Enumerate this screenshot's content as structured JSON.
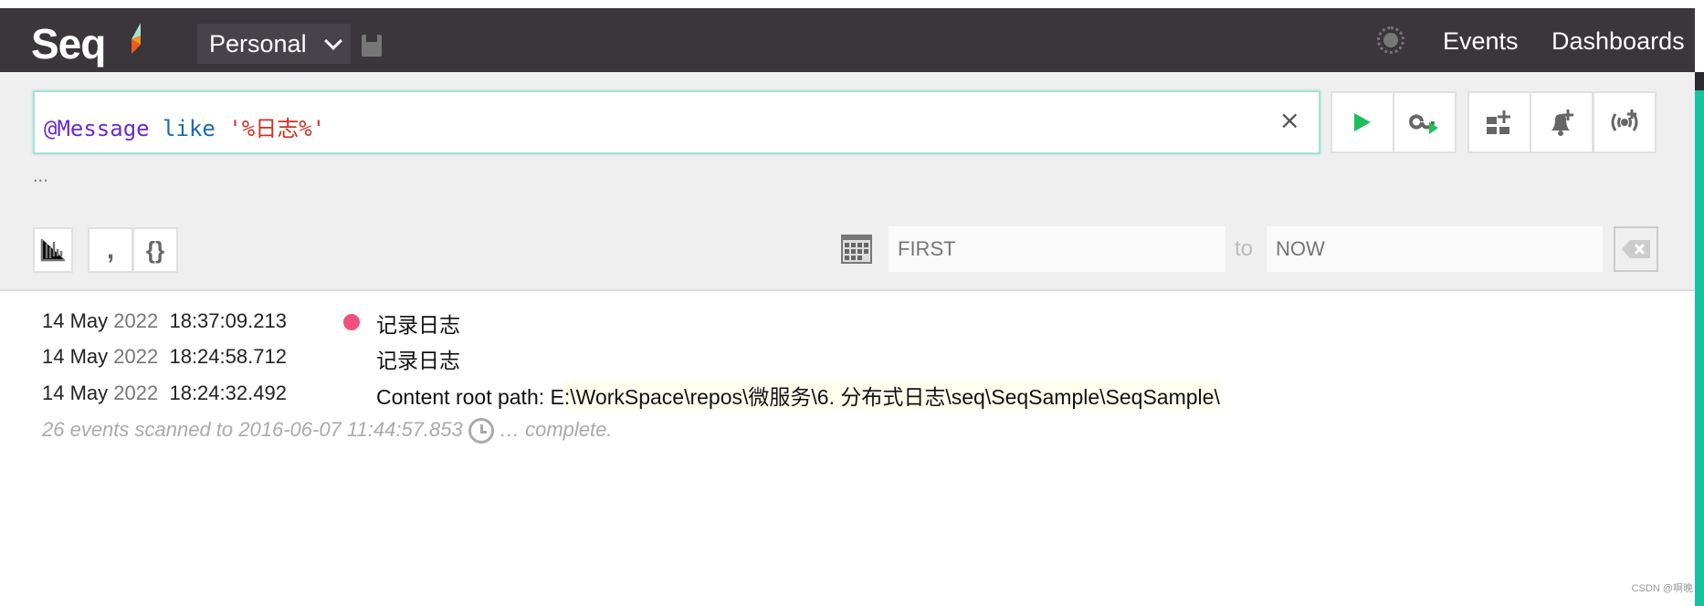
{
  "header": {
    "logo": "Seq",
    "signal": "Personal",
    "nav": [
      "Events",
      "Dashboards"
    ]
  },
  "query": {
    "property": "@Message",
    "keyword": "like",
    "string": "'%日志%'",
    "clear": "×",
    "ellipsis": "..."
  },
  "range": {
    "from_placeholder": "FIRST",
    "to_label": "to",
    "to_placeholder": "NOW"
  },
  "events": [
    {
      "date": "14 May",
      "year": "2022",
      "time": "18:37:09.213",
      "level_color": "#f0507a",
      "message": "记录日志"
    },
    {
      "date": "14 May",
      "year": "2022",
      "time": "18:24:58.712",
      "message": "记录日志"
    },
    {
      "date": "14 May",
      "year": "2022",
      "time": "18:24:32.492",
      "message": "Content root path: E:\\WorkSpace\\repos\\微服务\\6. 分布式日志\\seq\\SeqSample\\SeqSample\\"
    }
  ],
  "status": {
    "scanned": "26 events scanned to 2016-06-07 11:44:57.853",
    "complete": "… complete."
  },
  "watermark": "CSDN @啊晚",
  "colors": {
    "header": "#3b353c",
    "accent": "#16c3a0",
    "run": "#1dbf5a"
  }
}
